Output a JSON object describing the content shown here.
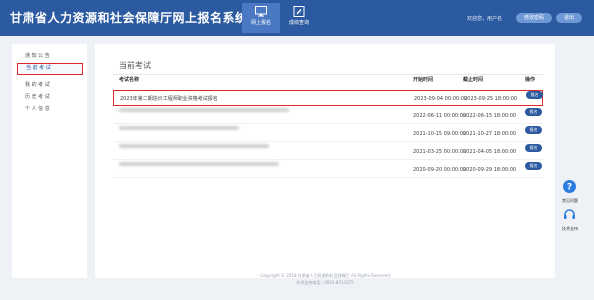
{
  "header": {
    "title": "甘肃省人力资源和社会保障厅网上报名系统",
    "nav": [
      {
        "label": "网上报名",
        "icon": "monitor-icon"
      },
      {
        "label": "成绩查询",
        "icon": "edit-icon"
      }
    ],
    "user_text": "欢迎您，用户名",
    "button_1": "修改密码",
    "button_2": "退出"
  },
  "sidebar": {
    "items": [
      {
        "label": "通 知 公 告"
      },
      {
        "label": "当 前 考 试"
      },
      {
        "label": "我 的 考 试"
      },
      {
        "label": "历 史 考 试"
      },
      {
        "label": "个 人 信 息"
      }
    ]
  },
  "main": {
    "section_title": "当前考试",
    "columns": {
      "name": "考试名称",
      "start": "开始时间",
      "end": "截止时间",
      "operation": "操作"
    },
    "rows": [
      {
        "name": "2023年第二期造价工程师职业资格考试报名",
        "start": "2023-09-04 00:00:00",
        "end": "2023-09-25 18:00:00",
        "action": "报名"
      },
      {
        "name": "",
        "start": "2022-06-11 00:00:00",
        "end": "2022-06-15 18:00:00",
        "action": "报名"
      },
      {
        "name": "",
        "start": "2021-10-15 09:00:00",
        "end": "2021-10-27 18:00:00",
        "action": "报名"
      },
      {
        "name": "",
        "start": "2021-03-25 00:00:00",
        "end": "2021-04-05 18:00:00",
        "action": "报名"
      },
      {
        "name": "",
        "start": "2020-09-20 00:00:00",
        "end": "2020-09-29 18:00:00",
        "action": "报名"
      }
    ]
  },
  "footer": {
    "line1": "Copyright © 2018 甘肃省人力资源和社会保障厅 All Rights Reserved",
    "line2": "技术支持电话：0931-8513375"
  },
  "floating": {
    "help_label": "常见问题",
    "support_label": "技术支持"
  },
  "colors": {
    "header_bg": "#2c5aa0",
    "accent": "#2c5aa0",
    "highlight_border": "#e0282b",
    "page_bg": "#eef2f7"
  }
}
